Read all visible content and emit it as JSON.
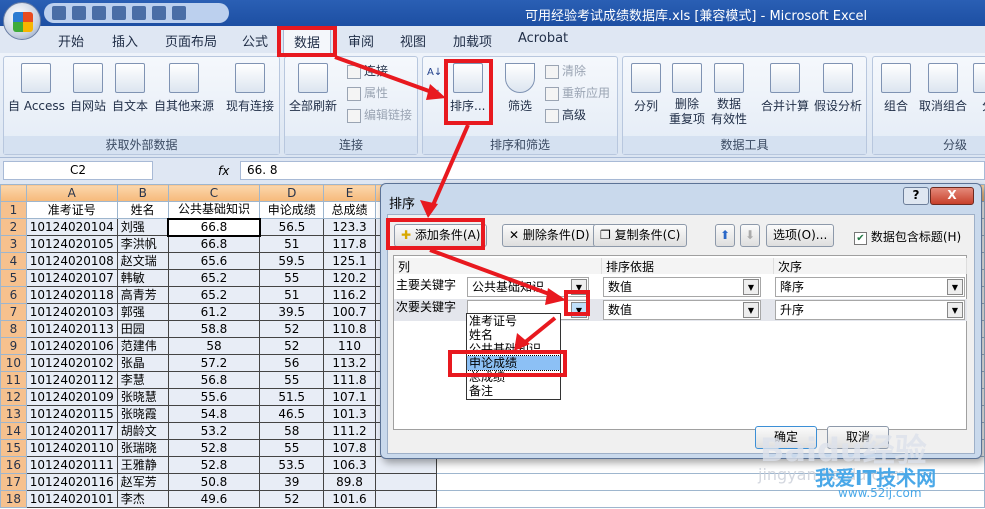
{
  "window": {
    "title": "可用经验考试成绩数据库.xls  [兼容模式] - Microsoft Excel"
  },
  "ribbon_tabs": [
    "开始",
    "插入",
    "页面布局",
    "公式",
    "数据",
    "审阅",
    "视图",
    "加载项",
    "Acrobat"
  ],
  "active_tab": "数据",
  "groups": {
    "external": {
      "label": "获取外部数据",
      "buttons": [
        "自 Access",
        "自网站",
        "自文本",
        "自其他来源",
        "现有连接"
      ]
    },
    "connections": {
      "label": "连接",
      "refresh": "全部刷新",
      "connect": "连接",
      "properties": "属性",
      "edit_links": "编辑链接"
    },
    "sort_filter": {
      "label": "排序和筛选",
      "sort": "排序...",
      "filter": "筛选",
      "clear": "清除",
      "reapply": "重新应用",
      "advanced": "高级"
    },
    "data_tools": {
      "label": "数据工具",
      "buttons": [
        "分列",
        "删除\n重复项",
        "数据\n有效性",
        "合并计算",
        "假设分析"
      ]
    },
    "outline": {
      "label": "分级",
      "buttons": [
        "组合",
        "取消组合",
        "分"
      ]
    }
  },
  "formula_bar": {
    "name_box": "C2",
    "fx": "fx",
    "value": "66. 8"
  },
  "sheet": {
    "columns": [
      "A",
      "B",
      "C",
      "D",
      "E",
      "F"
    ],
    "header": [
      "准考证号",
      "姓名",
      "公共基础知识",
      "申论成绩",
      "总成绩",
      ""
    ],
    "rows": [
      [
        "10124020104",
        "刘强",
        "66.8",
        "56.5",
        "123.3"
      ],
      [
        "10124020105",
        "李洪帆",
        "66.8",
        "51",
        "117.8"
      ],
      [
        "10124020108",
        "赵文瑞",
        "65.6",
        "59.5",
        "125.1"
      ],
      [
        "10124020107",
        "韩敏",
        "65.2",
        "55",
        "120.2"
      ],
      [
        "10124020118",
        "高青芳",
        "65.2",
        "51",
        "116.2"
      ],
      [
        "10124020103",
        "郭强",
        "61.2",
        "39.5",
        "100.7"
      ],
      [
        "10124020113",
        "田园",
        "58.8",
        "52",
        "110.8"
      ],
      [
        "10124020106",
        "范建伟",
        "58",
        "52",
        "110"
      ],
      [
        "10124020102",
        "张晶",
        "57.2",
        "56",
        "113.2"
      ],
      [
        "10124020112",
        "李慧",
        "56.8",
        "55",
        "111.8"
      ],
      [
        "10124020109",
        "张晓慧",
        "55.6",
        "51.5",
        "107.1"
      ],
      [
        "10124020115",
        "张晓霞",
        "54.8",
        "46.5",
        "101.3"
      ],
      [
        "10124020117",
        "胡龄文",
        "53.2",
        "58",
        "111.2"
      ],
      [
        "10124020110",
        "张瑞晓",
        "52.8",
        "55",
        "107.8"
      ],
      [
        "10124020111",
        "王雅静",
        "52.8",
        "53.5",
        "106.3"
      ],
      [
        "10124020116",
        "赵军芳",
        "50.8",
        "39",
        "89.8"
      ],
      [
        "10124020101",
        "李杰",
        "49.6",
        "52",
        "101.6"
      ]
    ]
  },
  "sort_dialog": {
    "title": "排序",
    "help": "?",
    "close": "X",
    "add": "添加条件(A)",
    "delete": "删除条件(D)",
    "copy": "复制条件(C)",
    "options": "选项(O)...",
    "has_header": "数据包含标题(H)",
    "has_header_checked": true,
    "col_headers": [
      "列",
      "排序依据",
      "次序"
    ],
    "rows": [
      {
        "label": "主要关键字",
        "column": "公共基础知识",
        "sort_on": "数值",
        "order": "降序"
      },
      {
        "label": "次要关键字",
        "column": "",
        "sort_on": "数值",
        "order": "升序"
      }
    ],
    "dropdown_options": [
      "准考证号",
      "姓名",
      "公共基础知识",
      "申论成绩",
      "总成绩",
      "备注"
    ],
    "highlighted_option": "申论成绩",
    "ok": "确定",
    "cancel": "取消"
  },
  "watermarks": {
    "baidu": "Baidu经验",
    "baidu_url": "jingyan.baidu.com",
    "site": "我爱IT技术网",
    "site_url": "www.52ij.com"
  },
  "annotation_color": "#e8191f"
}
